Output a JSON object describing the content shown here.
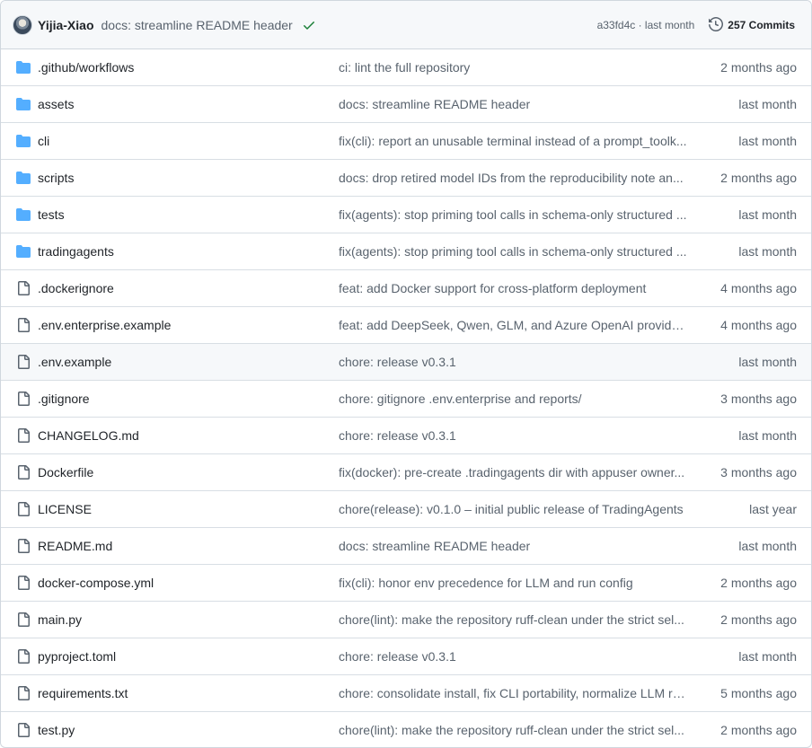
{
  "latest_commit": {
    "author": "Yijia-Xiao",
    "message": "docs: streamline README header",
    "sha_meta": "a33fd4c · last month",
    "commits_label": "257 Commits"
  },
  "colors": {
    "folder": "#54aeff",
    "success": "#1a7f37",
    "muted": "#59636e"
  },
  "rows": [
    {
      "type": "folder",
      "name": ".github/workflows",
      "message": "ci: lint the full repository",
      "age": "2 months ago"
    },
    {
      "type": "folder",
      "name": "assets",
      "message": "docs: streamline README header",
      "age": "last month"
    },
    {
      "type": "folder",
      "name": "cli",
      "message": "fix(cli): report an unusable terminal instead of a prompt_toolk...",
      "age": "last month"
    },
    {
      "type": "folder",
      "name": "scripts",
      "message": "docs: drop retired model IDs from the reproducibility note an...",
      "age": "2 months ago"
    },
    {
      "type": "folder",
      "name": "tests",
      "message": "fix(agents): stop priming tool calls in schema-only structured ...",
      "age": "last month"
    },
    {
      "type": "folder",
      "name": "tradingagents",
      "message": "fix(agents): stop priming tool calls in schema-only structured ...",
      "age": "last month"
    },
    {
      "type": "file",
      "name": ".dockerignore",
      "message": "feat: add Docker support for cross-platform deployment",
      "age": "4 months ago"
    },
    {
      "type": "file",
      "name": ".env.enterprise.example",
      "message": "feat: add DeepSeek, Qwen, GLM, and Azure OpenAI provider ...",
      "age": "4 months ago"
    },
    {
      "type": "file",
      "name": ".env.example",
      "message": "chore: release v0.3.1",
      "age": "last month"
    },
    {
      "type": "file",
      "name": ".gitignore",
      "message": "chore: gitignore .env.enterprise and reports/",
      "age": "3 months ago"
    },
    {
      "type": "file",
      "name": "CHANGELOG.md",
      "message": "chore: release v0.3.1",
      "age": "last month"
    },
    {
      "type": "file",
      "name": "Dockerfile",
      "message": "fix(docker): pre-create .tradingagents dir with appuser owner...",
      "age": "3 months ago"
    },
    {
      "type": "file",
      "name": "LICENSE",
      "message": "chore(release): v0.1.0 – initial public release of TradingAgents",
      "age": "last year"
    },
    {
      "type": "file",
      "name": "README.md",
      "message": "docs: streamline README header",
      "age": "last month"
    },
    {
      "type": "file",
      "name": "docker-compose.yml",
      "message": "fix(cli): honor env precedence for LLM and run config",
      "age": "2 months ago"
    },
    {
      "type": "file",
      "name": "main.py",
      "message": "chore(lint): make the repository ruff-clean under the strict sel...",
      "age": "2 months ago"
    },
    {
      "type": "file",
      "name": "pyproject.toml",
      "message": "chore: release v0.3.1",
      "age": "last month"
    },
    {
      "type": "file",
      "name": "requirements.txt",
      "message": "chore: consolidate install, fix CLI portability, normalize LLM re...",
      "age": "5 months ago"
    },
    {
      "type": "file",
      "name": "test.py",
      "message": "chore(lint): make the repository ruff-clean under the strict sel...",
      "age": "2 months ago"
    }
  ]
}
